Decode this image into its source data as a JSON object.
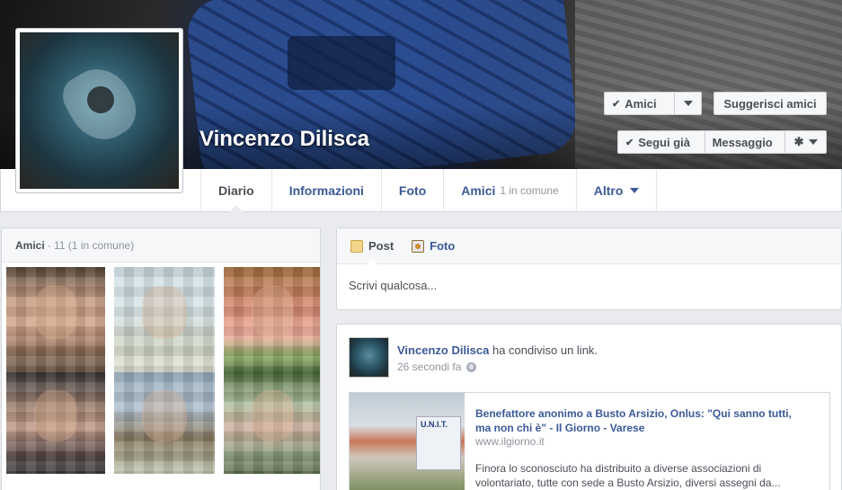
{
  "profile": {
    "name": "Vincenzo Dilisca"
  },
  "actions": {
    "friends_label": "Amici",
    "suggest_label": "Suggerisci amici",
    "following_label": "Segui già",
    "message_label": "Messaggio",
    "friends_icon": "check-icon",
    "following_icon": "check-icon",
    "settings_icon": "gear-icon"
  },
  "tabs": [
    {
      "label": "Diario",
      "sub": ""
    },
    {
      "label": "Informazioni",
      "sub": ""
    },
    {
      "label": "Foto",
      "sub": ""
    },
    {
      "label": "Amici",
      "sub": "1 in comune"
    },
    {
      "label": "Altro",
      "sub": ""
    }
  ],
  "friends_box": {
    "title": "Amici",
    "count": "· 11 (1 in comune)"
  },
  "composer": {
    "tab_post": "Post",
    "tab_photo": "Foto",
    "placeholder": "Scrivi qualcosa..."
  },
  "story": {
    "author": "Vincenzo Dilisca",
    "action": " ha condiviso un link.",
    "time": "26 secondi fa",
    "link_title": "Benefattore anonimo a Busto Arsizio, Onlus: \"Qui sanno tutti, ma non chi è\" - Il Giorno - Varese",
    "link_domain": "www.ilgiorno.it",
    "link_desc": "Finora lo sconosciuto ha distribuito a diverse associazioni di volontariato, tutte con sede a Busto Arsizio, diversi assegni da...",
    "thumb_sign": "U.N.I.T."
  },
  "colors": {
    "link_blue": "#3b5998",
    "page_bg": "#e9ebee"
  }
}
